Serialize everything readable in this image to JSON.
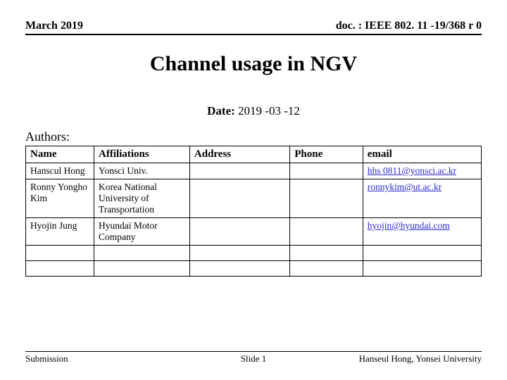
{
  "header": {
    "left": "March 2019",
    "right": "doc. : IEEE 802. 11 -19/368 r 0"
  },
  "title": "Channel usage in NGV",
  "date": {
    "label": "Date:",
    "value": "2019 -03 -12"
  },
  "authors_label": "Authors:",
  "table": {
    "headers": [
      "Name",
      "Affiliations",
      "Address",
      "Phone",
      "email"
    ],
    "rows": [
      {
        "name": "Hanscul Hong",
        "aff": "Yonsci Univ.",
        "addr": "",
        "phone": "",
        "email": "hhs 0811@yonsci.ac.kr"
      },
      {
        "name": "Ronny Yongho Kim",
        "aff": "Korea National University of Transportation",
        "addr": "",
        "phone": "",
        "email": "ronnykim@ut.ac.kr"
      },
      {
        "name": "Hyojin Jung",
        "aff": "Hyundai Motor Company",
        "addr": "",
        "phone": "",
        "email": "hyojin@hyundai.com"
      },
      {
        "name": "",
        "aff": "",
        "addr": "",
        "phone": "",
        "email": ""
      },
      {
        "name": "",
        "aff": "",
        "addr": "",
        "phone": "",
        "email": ""
      }
    ]
  },
  "footer": {
    "left": "Submission",
    "center": "Slide 1",
    "right": "Hanseul Hong, Yonsei University"
  }
}
